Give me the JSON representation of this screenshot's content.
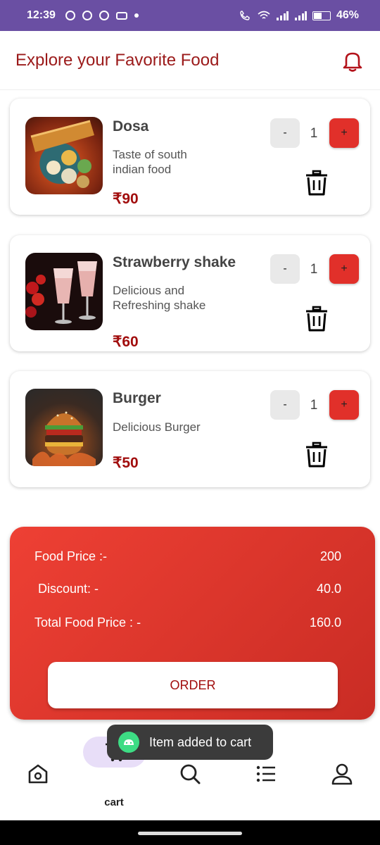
{
  "status_bar": {
    "time": "12:39",
    "battery": "46%"
  },
  "header": {
    "title": "Explore your Favorite Food",
    "notification_icon": "bell-icon"
  },
  "cart_items": [
    {
      "name": "Dosa",
      "description": "Taste of south indian food",
      "price": "₹90",
      "quantity": "1",
      "minus_label": "-",
      "plus_label": "+"
    },
    {
      "name": "Strawberry shake",
      "description": "Delicious and Refreshing shake",
      "price": "₹60",
      "quantity": "1",
      "minus_label": "-",
      "plus_label": "+"
    },
    {
      "name": "Burger",
      "description": "Delicious Burger",
      "price": "₹50",
      "quantity": "1",
      "minus_label": "-",
      "plus_label": "+"
    }
  ],
  "summary": {
    "food_price_label": "Food Price :-",
    "food_price_value": "200",
    "discount_label": "Discount: -",
    "discount_value": "40.0",
    "total_label": "Total Food Price : -",
    "total_value": "160.0",
    "order_button": "ORDER"
  },
  "toast": {
    "message": "Item added to cart"
  },
  "bottom_nav": {
    "active_label": "cart",
    "items": [
      "home-icon",
      "cart-icon",
      "search-icon",
      "list-icon",
      "profile-icon"
    ]
  },
  "colors": {
    "accent": "#e1302a",
    "header_title": "#9b1a1a",
    "price": "#a10d0d",
    "status_bar": "#6a4fa3"
  }
}
